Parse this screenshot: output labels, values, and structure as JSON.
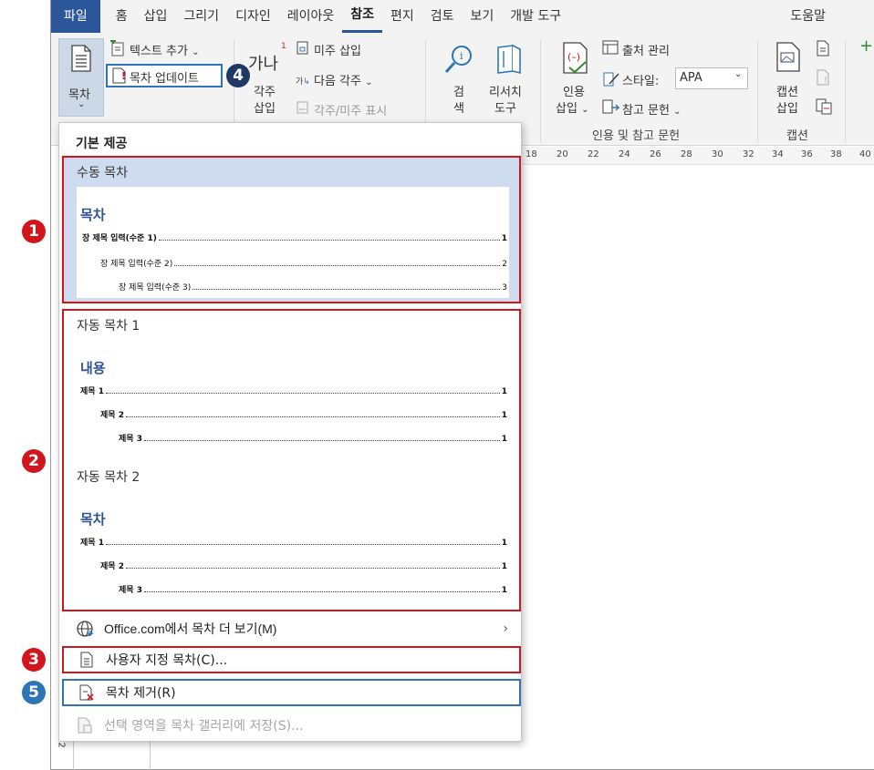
{
  "menubar": {
    "tabs": [
      "파일",
      "홈",
      "삽입",
      "그리기",
      "디자인",
      "레이아웃",
      "참조",
      "편지",
      "검토",
      "보기",
      "개발 도구"
    ],
    "active_tab": "참조",
    "help": "도움말"
  },
  "ribbon": {
    "toc_label": "목차",
    "add_text": "텍스트 추가",
    "update_toc": "목차 업데이트",
    "footnote_big_glyph": "가나",
    "footnote_label1": "각주",
    "footnote_label2": "삽입",
    "insert_endnote": "미주 삽입",
    "next_footnote": "다음 각주",
    "show_notes": "각주/미주 표시",
    "search1": "검",
    "search2": "색",
    "researcher1": "리서치",
    "researcher2": "도구",
    "citation1": "인용",
    "citation2": "삽입",
    "manage_sources": "출처 관리",
    "style_label": "스타일:",
    "style_value": "APA",
    "bibliography": "참고 문헌",
    "group_citations": "인용 및 참고 문헌",
    "caption1": "캡션",
    "caption2": "삽입",
    "group_captions": "캡션"
  },
  "ruler": [
    "18",
    "20",
    "22",
    "24",
    "26",
    "28",
    "30",
    "32",
    "34",
    "36",
    "38",
    "40"
  ],
  "dropdown": {
    "header": "기본 제공",
    "manual": {
      "title": "수동 목차",
      "heading": "목차",
      "lines": [
        {
          "label": "장 제목 입력(수준 1)",
          "page": "1"
        },
        {
          "label": "장 제목 입력(수준 2)",
          "page": "2"
        },
        {
          "label": "장 제목 입력(수준 3)",
          "page": "3"
        }
      ]
    },
    "auto1": {
      "title": "자동 목차 1",
      "heading": "내용",
      "lines": [
        {
          "label": "제목 1",
          "page": "1"
        },
        {
          "label": "제목 2",
          "page": "1"
        },
        {
          "label": "제목 3",
          "page": "1"
        }
      ]
    },
    "auto2": {
      "title": "자동 목차 2",
      "heading": "목차",
      "lines": [
        {
          "label": "제목 1",
          "page": "1"
        },
        {
          "label": "제목 2",
          "page": "1"
        },
        {
          "label": "제목 3",
          "page": "1"
        }
      ]
    },
    "more_office": "Office.com에서 목차 더 보기(M)",
    "custom_toc": "사용자 지정 목차(C)...",
    "remove_toc": "목차 제거(R)",
    "save_selection": "선택 영역을 목차 갤러리에 저장(S)..."
  },
  "markers": [
    "1",
    "2",
    "3",
    "4",
    "5"
  ],
  "colors": {
    "accent": "#2b579a",
    "highlight_red": "#d3161e",
    "highlight_blue": "#2e75b6",
    "toc_heading": "#2f5496"
  }
}
